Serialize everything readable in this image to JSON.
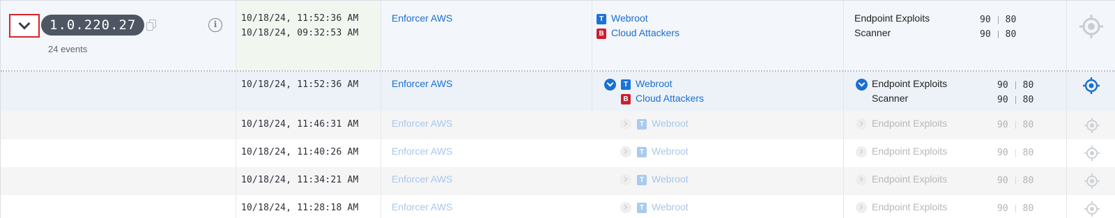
{
  "group": {
    "ip": "1.0.220.27",
    "events_label": "24 events",
    "times": [
      "10/18/24, 11:52:36 AM",
      "10/18/24, 09:32:53 AM"
    ],
    "source": "Enforcer AWS",
    "providers": [
      {
        "badge": "T",
        "name": "Webroot"
      },
      {
        "badge": "B",
        "name": "Cloud Attackers"
      }
    ],
    "labels": [
      {
        "name": "Endpoint Exploits",
        "score_a": "90",
        "score_b": "80"
      },
      {
        "name": "Scanner",
        "score_a": "90",
        "score_b": "80"
      }
    ]
  },
  "events": [
    {
      "time": "10/18/24, 11:52:36 AM",
      "source": "Enforcer AWS",
      "providers": [
        {
          "badge": "T",
          "name": "Webroot"
        },
        {
          "badge": "B",
          "name": "Cloud Attackers"
        }
      ],
      "labels": [
        {
          "name": "Endpoint Exploits",
          "score_a": "90",
          "score_b": "80"
        },
        {
          "name": "Scanner",
          "score_a": "90",
          "score_b": "80"
        }
      ]
    },
    {
      "time": "10/18/24, 11:46:31 AM",
      "source": "Enforcer AWS",
      "provider": {
        "badge": "T",
        "name": "Webroot"
      },
      "label": {
        "name": "Endpoint Exploits",
        "score_a": "90",
        "score_b": "80"
      }
    },
    {
      "time": "10/18/24, 11:40:26 AM",
      "source": "Enforcer AWS",
      "provider": {
        "badge": "T",
        "name": "Webroot"
      },
      "label": {
        "name": "Endpoint Exploits",
        "score_a": "90",
        "score_b": "80"
      }
    },
    {
      "time": "10/18/24, 11:34:21 AM",
      "source": "Enforcer AWS",
      "provider": {
        "badge": "T",
        "name": "Webroot"
      },
      "label": {
        "name": "Endpoint Exploits",
        "score_a": "90",
        "score_b": "80"
      }
    },
    {
      "time": "10/18/24, 11:28:18 AM",
      "source": "Enforcer AWS",
      "provider": {
        "badge": "T",
        "name": "Webroot"
      },
      "label": {
        "name": "Endpoint Exploits",
        "score_a": "90",
        "score_b": "80"
      }
    }
  ],
  "colors": {
    "accent": "#1a6fd0",
    "badge_t": "#1a73d9",
    "badge_b": "#cc1f2f",
    "highlight_border": "#d8232a"
  },
  "icons": [
    "chevron-down-icon",
    "copy-icon",
    "info-icon",
    "crosshair-target-icon",
    "check-circle-icon",
    "chevron-right-circle-icon"
  ]
}
